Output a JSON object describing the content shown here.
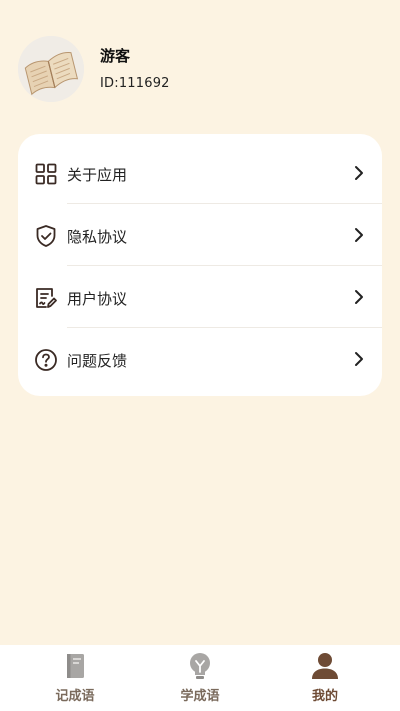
{
  "profile": {
    "name": "游客",
    "id_text": "ID:111692",
    "avatar_icon": "book-avatar-icon"
  },
  "menu": {
    "items": [
      {
        "label": "关于应用",
        "icon": "grid-icon"
      },
      {
        "label": "隐私协议",
        "icon": "shield-check-icon"
      },
      {
        "label": "用户协议",
        "icon": "document-edit-icon"
      },
      {
        "label": "问题反馈",
        "icon": "question-circle-icon"
      }
    ],
    "chevron_icon": "chevron-right-icon"
  },
  "tabbar": {
    "tabs": [
      {
        "label": "记成语",
        "icon": "notebook-icon",
        "active": false
      },
      {
        "label": "学成语",
        "icon": "lightbulb-icon",
        "active": false
      },
      {
        "label": "我的",
        "icon": "user-icon",
        "active": true
      }
    ]
  },
  "colors": {
    "background": "#fcf3e2",
    "card": "#ffffff",
    "icon_dark": "#3a2a24",
    "active_tab": "#6e4b35",
    "inactive_tab": "#7a6a5c"
  }
}
